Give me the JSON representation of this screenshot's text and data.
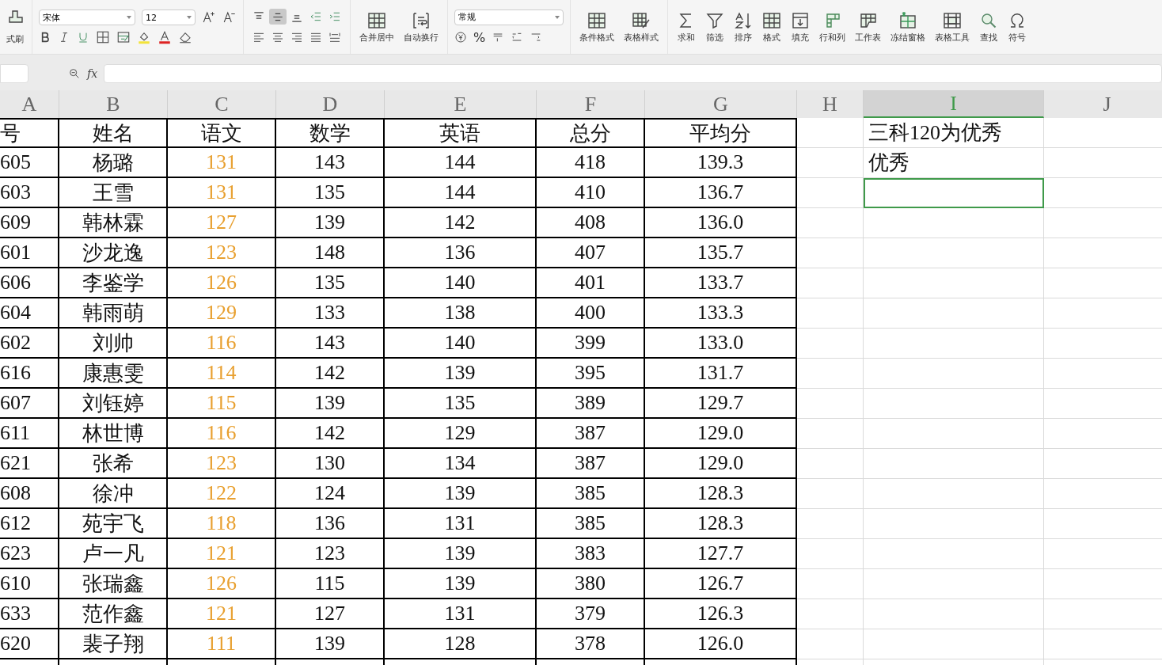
{
  "toolbar": {
    "format_painter": "式刷",
    "font_name": "宋体",
    "font_size": "12",
    "vertical_align": [
      {
        "selected": false
      },
      {
        "selected": true
      },
      {
        "selected": false
      }
    ],
    "merge": "合并居中",
    "wrap": "自动换行",
    "number_format": "常规",
    "percent": "%",
    "conditional_format": "条件格式",
    "table_style": "表格样式",
    "tools": [
      "求和",
      "筛选",
      "排序",
      "格式",
      "填充",
      "行和列",
      "工作表",
      "冻结窗格",
      "表格工具",
      "查找",
      "符号"
    ]
  },
  "formula_bar": {
    "fx": "fx"
  },
  "columns": [
    {
      "letter": "A",
      "selected": false
    },
    {
      "letter": "B",
      "selected": false
    },
    {
      "letter": "C",
      "selected": false
    },
    {
      "letter": "D",
      "selected": false
    },
    {
      "letter": "E",
      "selected": false
    },
    {
      "letter": "F",
      "selected": false
    },
    {
      "letter": "G",
      "selected": false
    },
    {
      "letter": "H",
      "selected": false
    },
    {
      "letter": "I",
      "selected": true
    },
    {
      "letter": "J",
      "selected": false
    }
  ],
  "headers": [
    {
      "text": "号",
      "highlighted": false
    },
    {
      "text": "姓名",
      "highlighted": false
    },
    {
      "text": "语文",
      "highlighted": true
    },
    {
      "text": "数学",
      "highlighted": false
    },
    {
      "text": "英语",
      "highlighted": false
    },
    {
      "text": "总分",
      "highlighted": false
    },
    {
      "text": "平均分",
      "highlighted": false
    }
  ],
  "rows": [
    [
      "605",
      "杨璐",
      "131",
      "143",
      "144",
      "418",
      "139.3"
    ],
    [
      "603",
      "王雪",
      "131",
      "135",
      "144",
      "410",
      "136.7"
    ],
    [
      "609",
      "韩林霖",
      "127",
      "139",
      "142",
      "408",
      "136.0"
    ],
    [
      "601",
      "沙龙逸",
      "123",
      "148",
      "136",
      "407",
      "135.7"
    ],
    [
      "606",
      "李鉴学",
      "126",
      "135",
      "140",
      "401",
      "133.7"
    ],
    [
      "604",
      "韩雨萌",
      "129",
      "133",
      "138",
      "400",
      "133.3"
    ],
    [
      "602",
      "刘帅",
      "116",
      "143",
      "140",
      "399",
      "133.0"
    ],
    [
      "616",
      "康惠雯",
      "114",
      "142",
      "139",
      "395",
      "131.7"
    ],
    [
      "607",
      "刘钰婷",
      "115",
      "139",
      "135",
      "389",
      "129.7"
    ],
    [
      "611",
      "林世博",
      "116",
      "142",
      "129",
      "387",
      "129.0"
    ],
    [
      "621",
      "张希",
      "123",
      "130",
      "134",
      "387",
      "129.0"
    ],
    [
      "608",
      "徐冲",
      "122",
      "124",
      "139",
      "385",
      "128.3"
    ],
    [
      "612",
      "苑宇飞",
      "118",
      "136",
      "131",
      "385",
      "128.3"
    ],
    [
      "623",
      "卢一凡",
      "121",
      "123",
      "139",
      "383",
      "127.7"
    ],
    [
      "610",
      "张瑞鑫",
      "126",
      "115",
      "139",
      "380",
      "126.7"
    ],
    [
      "633",
      "范作鑫",
      "121",
      "127",
      "131",
      "379",
      "126.3"
    ],
    [
      "620",
      "裴子翔",
      "111",
      "139",
      "128",
      "378",
      "126.0"
    ]
  ],
  "side_cells": [
    {
      "text": "三科120为优秀",
      "selected": false
    },
    {
      "text": "优秀",
      "selected": false
    },
    {
      "selected": true
    }
  ]
}
